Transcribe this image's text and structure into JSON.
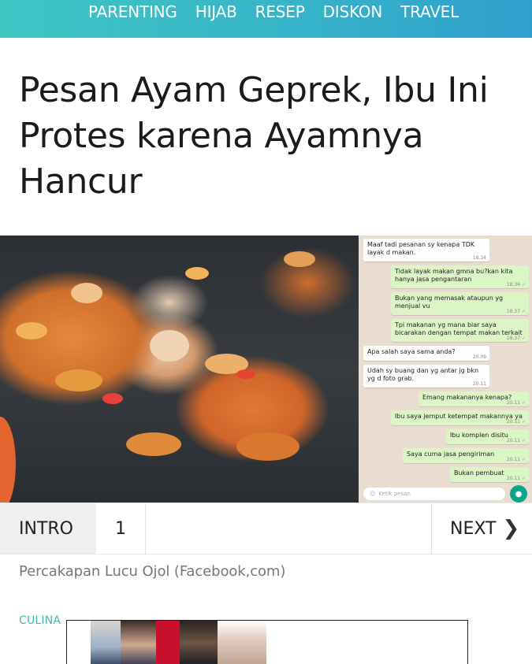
{
  "nav": {
    "items": [
      "PARENTING",
      "HIJAB",
      "RESEP",
      "DISKON",
      "TRAVEL"
    ],
    "bg_color": "#3ab8c8"
  },
  "article": {
    "title": "Pesan Ayam Geprek, Ibu Ini Protes karena Ayamnya Hancur",
    "caption": "Percakapan Lucu Ojol (Facebook,com)",
    "category": "CULINA"
  },
  "chat": {
    "messages": [
      {
        "dir": "in",
        "text": "Maaf tadi pesanan sy kenapa TDK layak d makan.",
        "time": "18.34"
      },
      {
        "dir": "out",
        "text": "Tidak layak makan gmna bu?kan kita hanya jasa pengantaran",
        "time": "18.36"
      },
      {
        "dir": "out",
        "text": "Bukan yang memasak ataupun yg menjual vu",
        "time": "18.37"
      },
      {
        "dir": "out",
        "text": "Tpi makanan yg mana biar saya bicarakan dengan tempat makan terkait",
        "time": "18.37"
      },
      {
        "dir": "in",
        "text": "Apa salah saya sama anda?",
        "time": "20.09"
      },
      {
        "dir": "in",
        "text": "Udah sy buang dan yg antar jg bkn yg d foto grab.",
        "time": "20.11"
      },
      {
        "dir": "out",
        "text": "Emang makananya kenapa?",
        "time": "20.11"
      },
      {
        "dir": "out",
        "text": "Ibu saya jemput ketempat makannya ya",
        "time": "20.11"
      },
      {
        "dir": "out",
        "text": "Ibu komplen disitu",
        "time": "20.11"
      },
      {
        "dir": "out",
        "text": "Saya cuma jasa pengiriman",
        "time": "20.11"
      },
      {
        "dir": "out",
        "text": "Bukan pembuat",
        "time": "20.11"
      }
    ],
    "input_placeholder": "Ketik pesan"
  },
  "pager": {
    "intro_label": "INTRO",
    "current_page": "1",
    "next_label": "NEXT",
    "next_icon": "chevron-right-icon"
  }
}
